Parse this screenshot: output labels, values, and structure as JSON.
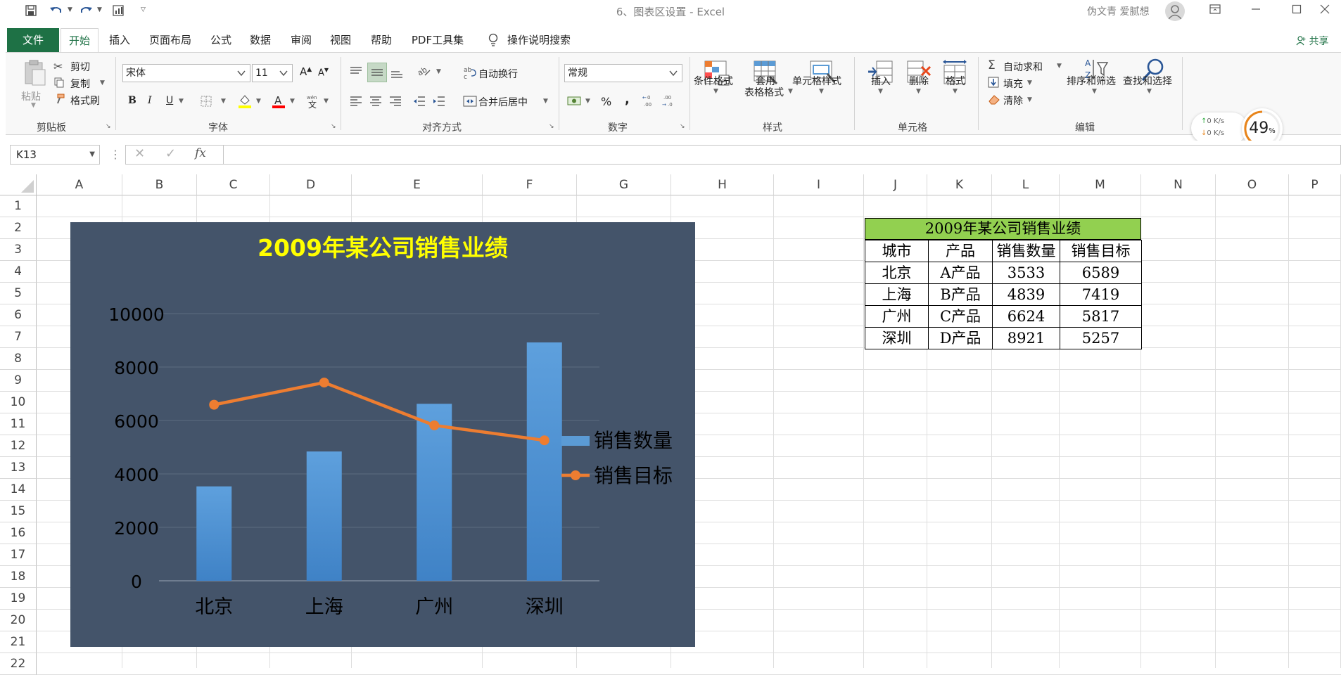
{
  "titlebar": {
    "document_title": "6、图表区设置  -  Excel",
    "user_name": "伪文青 爱腻想"
  },
  "ribbon_tabs": [
    {
      "label": "文件"
    },
    {
      "label": "开始"
    },
    {
      "label": "插入"
    },
    {
      "label": "页面布局"
    },
    {
      "label": "公式"
    },
    {
      "label": "数据"
    },
    {
      "label": "审阅"
    },
    {
      "label": "视图"
    },
    {
      "label": "帮助"
    },
    {
      "label": "PDF工具集"
    },
    {
      "label": "操作说明搜索"
    }
  ],
  "share_label": "共享",
  "ribbon": {
    "clipboard": {
      "paste": "粘贴",
      "cut": "剪切",
      "copy": "复制",
      "format_painter": "格式刷",
      "label": "剪贴板"
    },
    "font": {
      "name": "宋体",
      "size": "11",
      "label": "字体",
      "bold": "B",
      "italic": "I",
      "underline": "U",
      "grow": "A",
      "shrink": "A"
    },
    "alignment": {
      "wrap": "自动换行",
      "merge": "合并后居中",
      "label": "对齐方式"
    },
    "number": {
      "format": "常规",
      "percent": "%",
      "comma": ",",
      "label": "数字"
    },
    "styles": {
      "conditional": "条件格式",
      "table_1": "套用",
      "table_2": "表格格式",
      "cell_styles": "单元格样式",
      "label": "样式"
    },
    "cells": {
      "insert": "插入",
      "delete": "删除",
      "format": "格式",
      "label": "单元格"
    },
    "editing": {
      "autosum": "自动求和",
      "fill": "填充",
      "clear": "清除",
      "sort": "排序和筛选",
      "find": "查找和选择",
      "label": "编辑"
    }
  },
  "network_widget": {
    "up": "0  K/s",
    "down": "0  K/s",
    "percent": "49",
    "percent_sign": "%"
  },
  "formula_bar": {
    "name_box": "K13",
    "fx": "fx",
    "content": ""
  },
  "columns": [
    "A",
    "B",
    "C",
    "D",
    "E",
    "F",
    "G",
    "H",
    "I",
    "J",
    "K",
    "L",
    "M",
    "N",
    "O",
    "P"
  ],
  "rows": [
    "1",
    "2",
    "3",
    "4",
    "5",
    "6",
    "7",
    "8",
    "9",
    "10",
    "11",
    "12",
    "13",
    "14",
    "15",
    "16",
    "17",
    "18",
    "19",
    "20",
    "21",
    "22"
  ],
  "table": {
    "title": "2009年某公司销售业绩",
    "headers": [
      "城市",
      "产品",
      "销售数量",
      "销售目标"
    ],
    "rows": [
      [
        "北京",
        "A产品",
        "3533",
        "6589"
      ],
      [
        "上海",
        "B产品",
        "4839",
        "7419"
      ],
      [
        "广州",
        "C产品",
        "6624",
        "5817"
      ],
      [
        "深圳",
        "D产品",
        "8921",
        "5257"
      ]
    ],
    "header_color": "#92d050"
  },
  "chart_data": {
    "type": "bar",
    "title": "2009年某公司销售业绩",
    "categories": [
      "北京",
      "上海",
      "广州",
      "深圳"
    ],
    "series": [
      {
        "name": "销售数量",
        "type": "bar",
        "values": [
          3533,
          4839,
          6624,
          8921
        ],
        "color": "#5b9bd5"
      },
      {
        "name": "销售目标",
        "type": "line",
        "values": [
          6589,
          7419,
          5817,
          5257
        ],
        "color": "#ed7d31"
      }
    ],
    "yticks": [
      "0",
      "2000",
      "4000",
      "6000",
      "8000",
      "10000"
    ],
    "ylim": [
      0,
      10000
    ],
    "legend": "right",
    "grid": true,
    "background": "#44546a",
    "title_color": "#ffff00"
  },
  "colors": {
    "accent": "#1e7145",
    "chart_bg": "#44546a"
  }
}
